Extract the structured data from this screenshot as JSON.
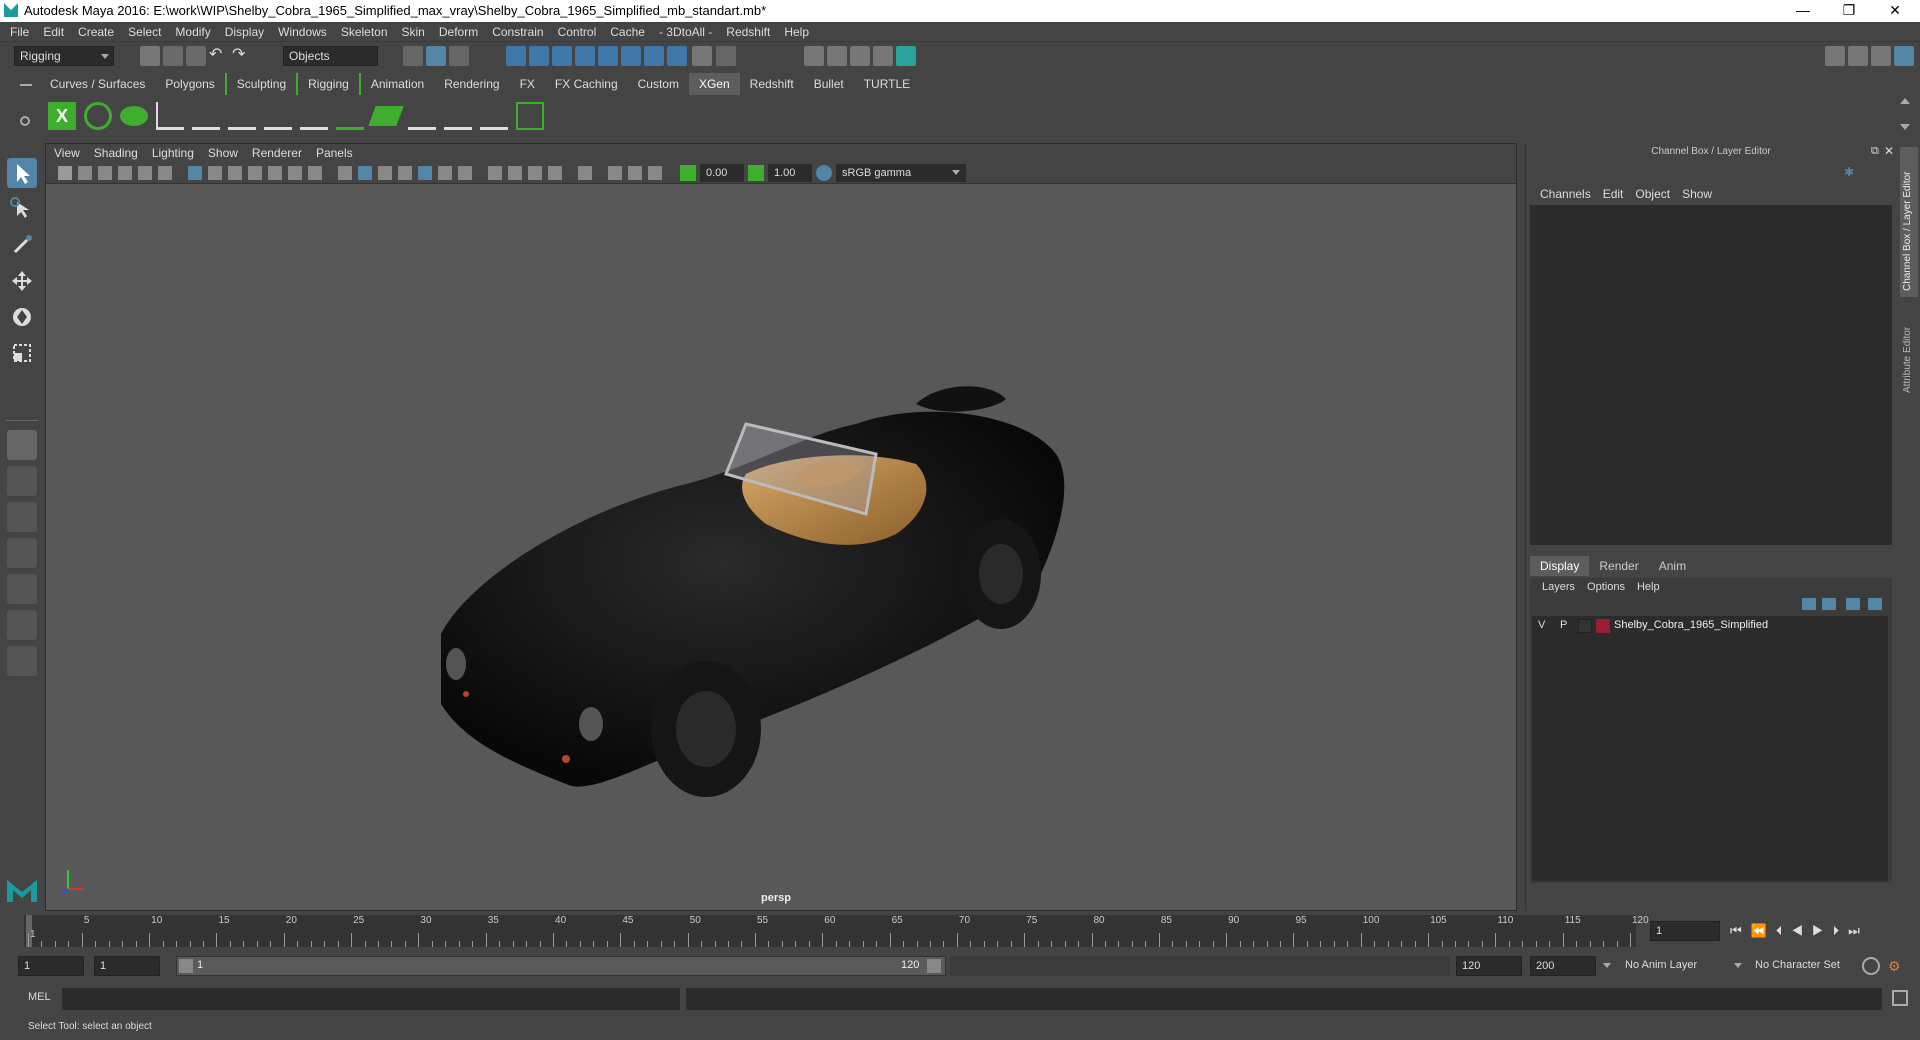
{
  "window": {
    "title": "Autodesk Maya 2016: E:\\work\\WIP\\Shelby_Cobra_1965_Simplified_max_vray\\Shelby_Cobra_1965_Simplified_mb_standart.mb*",
    "minimize": "—",
    "maximize": "❐",
    "close": "✕"
  },
  "menubar": [
    "File",
    "Edit",
    "Create",
    "Select",
    "Modify",
    "Display",
    "Windows",
    "Skeleton",
    "Skin",
    "Deform",
    "Constrain",
    "Control",
    "Cache",
    "- 3DtoAll -",
    "Redshift",
    "Help"
  ],
  "statusline": {
    "menuset": "Rigging",
    "selection_mode": "Objects"
  },
  "shelf_tabs": [
    "Curves / Surfaces",
    "Polygons",
    "Sculpting",
    "Rigging",
    "Animation",
    "Rendering",
    "FX",
    "FX Caching",
    "Custom",
    "XGen",
    "Redshift",
    "Bullet",
    "TURTLE"
  ],
  "shelf_active": "XGen",
  "viewport": {
    "menu": [
      "View",
      "Shading",
      "Lighting",
      "Show",
      "Renderer",
      "Panels"
    ],
    "exposure": "0.00",
    "gamma": "1.00",
    "color_space": "sRGB gamma",
    "camera": "persp"
  },
  "channel_box": {
    "title": "Channel Box / Layer Editor",
    "menu": [
      "Channels",
      "Edit",
      "Object",
      "Show"
    ]
  },
  "layer_editor": {
    "tabs": [
      "Display",
      "Render",
      "Anim"
    ],
    "active_tab": "Display",
    "menu": [
      "Layers",
      "Options",
      "Help"
    ],
    "layers": [
      {
        "v": "V",
        "p": "P",
        "name": "Shelby_Cobra_1965_Simplified",
        "color": "#9b1b30"
      }
    ]
  },
  "side_tabs": [
    "Channel Box / Layer Editor",
    "Attribute Editor"
  ],
  "timeline": {
    "ticks": [
      "1",
      "5",
      "10",
      "15",
      "20",
      "25",
      "30",
      "35",
      "40",
      "45",
      "50",
      "55",
      "60",
      "65",
      "70",
      "75",
      "80",
      "85",
      "90",
      "95",
      "100",
      "105",
      "110",
      "115",
      "120"
    ],
    "current_frame": "1"
  },
  "range": {
    "start": "1",
    "playback_start": "1",
    "slider_start": "1",
    "slider_end": "120",
    "playback_end": "120",
    "end": "200",
    "anim_layer": "No Anim Layer",
    "character_set": "No Character Set"
  },
  "command_line": {
    "label": "MEL"
  },
  "help_line": "Select Tool: select an object",
  "colors": {
    "accent": "#5285a6",
    "bg": "#444444",
    "viewport": "#585858",
    "shelf_green": "#3fae2e"
  }
}
